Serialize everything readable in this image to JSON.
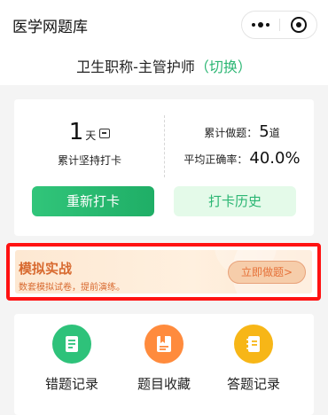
{
  "nav": {
    "title": "医学网题库"
  },
  "subject": {
    "name": "卫生职称-主管护师",
    "switch_label": "（切换）"
  },
  "stats": {
    "streak_days": "1",
    "streak_unit": "天",
    "streak_label": "累计坚持打卡",
    "total_label": "累计做题：",
    "total_value": "5",
    "total_unit": "道",
    "accuracy_label": "平均正确率：",
    "accuracy_value": "40.0%",
    "checkin_button": "重新打卡",
    "history_button": "打卡历史"
  },
  "banner": {
    "title": "模拟实战",
    "subtitle": "数套模拟试卷，提前演练。",
    "button": "立即做题>"
  },
  "menu": {
    "items": [
      {
        "label": "错题记录",
        "icon": "book-icon",
        "color": "#2ec27a"
      },
      {
        "label": "题目收藏",
        "icon": "bookmark-book-icon",
        "color": "#ff8b3d"
      },
      {
        "label": "答题记录",
        "icon": "notebook-icon",
        "color": "#f7b617"
      }
    ]
  },
  "colors": {
    "accent_green": "#2bb673",
    "banner_orange": "#d86a30",
    "highlight_red": "#ff1212"
  }
}
